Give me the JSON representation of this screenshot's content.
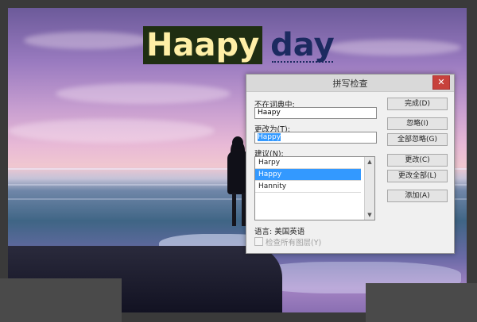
{
  "headline": {
    "selected_text": "Haapy",
    "rest_text": "day"
  },
  "dialog": {
    "title": "拼写检查",
    "close_glyph": "✕",
    "not_in_dict_label": "不在词典中:",
    "not_in_dict_value": "Haapy",
    "change_to_label": "更改为(T):",
    "change_to_value": "Happy",
    "suggestions_label": "建议(N):",
    "suggestions": [
      "Harpy",
      "Happy",
      "Hannity"
    ],
    "selected_suggestion": "Happy",
    "language_label": "语言: 美国英语",
    "check_all_layers_label": "检查所有图层(Y)",
    "check_all_layers_checked": false,
    "buttons": {
      "done": "完成(D)",
      "ignore": "忽略(I)",
      "ignore_all": "全部忽略(G)",
      "change": "更改(C)",
      "change_all": "更改全部(L)",
      "add": "添加(A)"
    }
  },
  "colors": {
    "selection_highlight": "#3399ff",
    "close_button": "#c7413b",
    "headline_selection_bg": "#1f2e12",
    "headline_selected_text": "#ffefa6",
    "headline_text": "#1c2a60"
  }
}
